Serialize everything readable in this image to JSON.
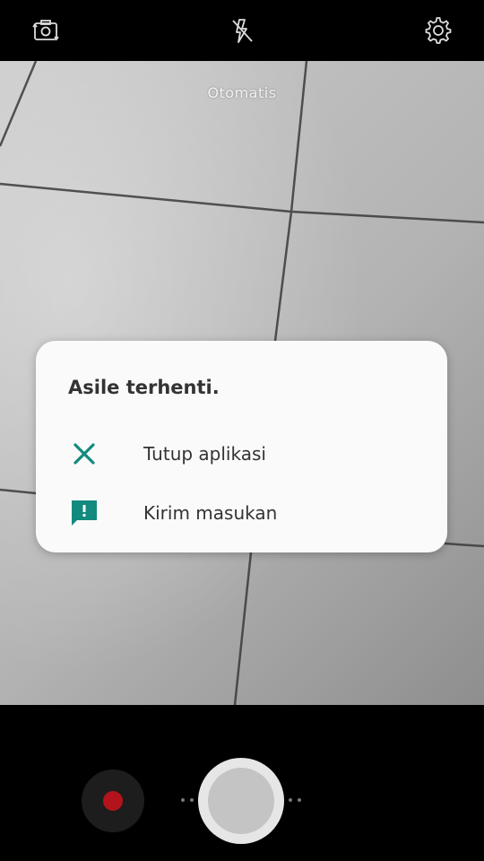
{
  "viewfinder": {
    "mode_label": "Otomatis"
  },
  "topbar": {
    "icons": [
      "switch-camera-icon",
      "flash-off-icon",
      "settings-icon"
    ]
  },
  "dialog": {
    "title": "Asile terhenti.",
    "options": [
      {
        "label": "Tutup aplikasi",
        "icon": "close-icon"
      },
      {
        "label": "Kirim masukan",
        "icon": "feedback-icon"
      }
    ],
    "accent_color": "#138a7e"
  },
  "bottombar": {
    "record_color": "#b3141b"
  }
}
